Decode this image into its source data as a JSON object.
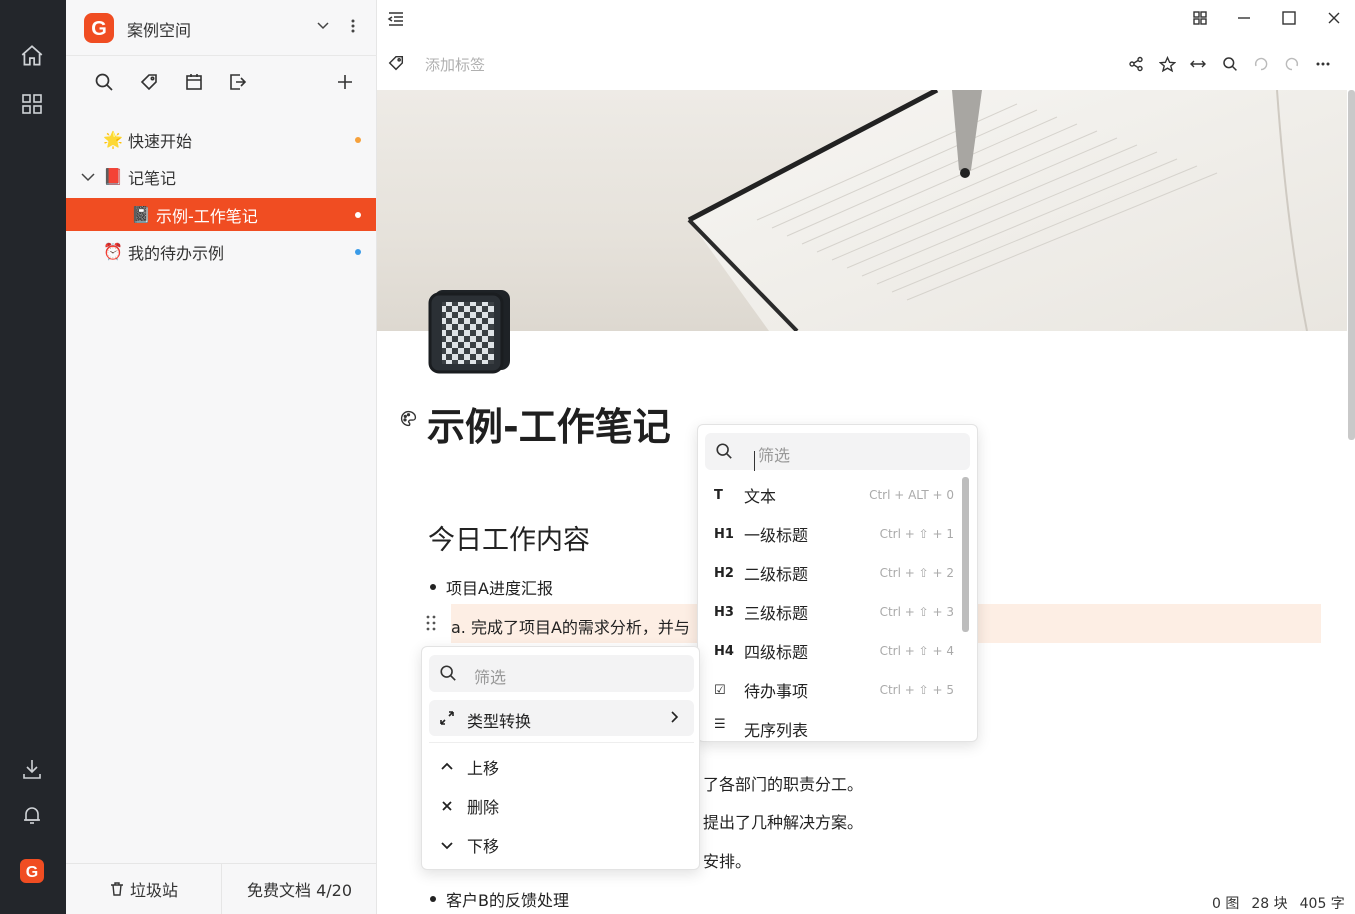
{
  "workspace": {
    "name": "案例空间"
  },
  "tree": [
    {
      "label": "快速开始",
      "emoji": "🌟",
      "dot": "#f6a13b"
    },
    {
      "label": "记笔记",
      "emoji": "📕"
    },
    {
      "label": "示例-工作笔记",
      "emoji": "📓",
      "dot": "#ffffff"
    },
    {
      "label": "我的待办示例",
      "emoji": "⏰",
      "dot": "#3a9be8"
    }
  ],
  "footer": {
    "trash": "垃圾站",
    "quota": "免费文档 4/20"
  },
  "topbar": {
    "tag_placeholder": "添加标签"
  },
  "doc": {
    "title": "示例-工作笔记",
    "heading": "今日工作内容",
    "bullet1": "项目A进度汇报",
    "highlight": "a. 完成了项目A的需求分析，并与",
    "line1": "了各部门的职责分工。",
    "line2": "提出了几种解决方案。",
    "line3": "安排。",
    "bullet2": "客户B的反馈处理"
  },
  "status": {
    "images": "0 图",
    "blocks": "28 块",
    "chars": "405 字"
  },
  "menu_right": {
    "filter_placeholder": "筛选",
    "options": [
      {
        "icon": "T",
        "label": "文本",
        "shortcut": "Ctrl + ALT + 0"
      },
      {
        "icon": "H1",
        "label": "一级标题",
        "shortcut": "Ctrl + ⇧ + 1"
      },
      {
        "icon": "H2",
        "label": "二级标题",
        "shortcut": "Ctrl + ⇧ + 2"
      },
      {
        "icon": "H3",
        "label": "三级标题",
        "shortcut": "Ctrl + ⇧ + 3"
      },
      {
        "icon": "H4",
        "label": "四级标题",
        "shortcut": "Ctrl + ⇧ + 4"
      },
      {
        "icon": "☑",
        "label": "待办事项",
        "shortcut": "Ctrl + ⇧ + 5"
      },
      {
        "icon": "☰",
        "label": "无序列表",
        "shortcut": ""
      }
    ]
  },
  "menu_left": {
    "filter_placeholder": "筛选",
    "type_convert": "类型转换",
    "move_up": "上移",
    "delete": "删除",
    "move_down": "下移"
  },
  "colors": {
    "accent": "#f04d22",
    "rail": "#23262b",
    "highlight": "#fdeee4"
  }
}
